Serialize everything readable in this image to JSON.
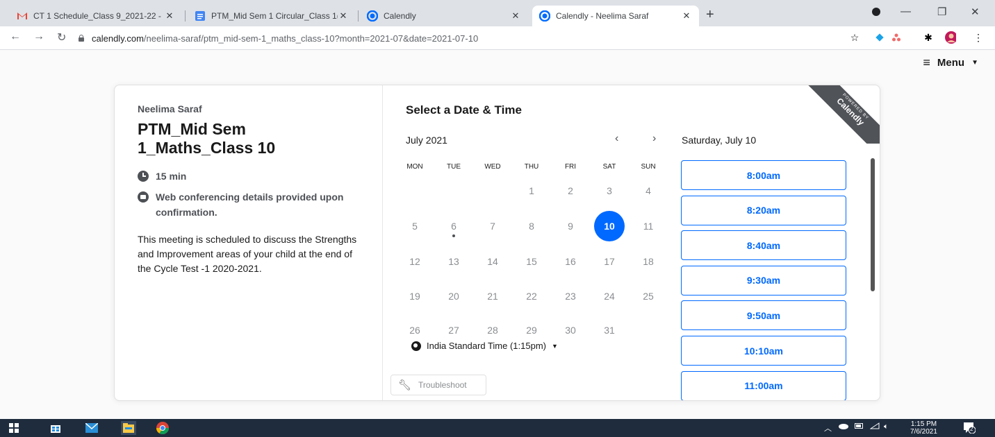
{
  "browser": {
    "tabs": [
      {
        "title": "CT 1 Schedule_Class 9_2021-22 -",
        "icon": "gmail-icon",
        "active": false
      },
      {
        "title": "PTM_Mid Sem 1 Circular_Class 1(",
        "icon": "docs-icon",
        "active": false
      },
      {
        "title": "Calendly",
        "icon": "calendly-icon",
        "active": false
      },
      {
        "title": "Calendly - Neelima Saraf",
        "icon": "calendly-icon",
        "active": true
      }
    ],
    "url_host": "calendly.com",
    "url_path": "/neelima-saraf/ptm_mid-sem-1_maths_class-10?month=2021-07&date=2021-07-10"
  },
  "header": {
    "menu_label": "Menu"
  },
  "event": {
    "organizer": "Neelima Saraf",
    "title": "PTM_Mid Sem 1_Maths_Class 10",
    "duration": "15 min",
    "location": "Web conferencing details provided upon confirmation.",
    "description": "This meeting is scheduled to discuss the Strengths and Improvement areas of your child at the end of the Cycle Test -1 2020-2021."
  },
  "scheduler": {
    "heading": "Select a Date & Time",
    "month": "July 2021",
    "prev_icon": "chevron-left-icon",
    "next_icon": "chevron-right-icon",
    "weekdays": [
      "MON",
      "TUE",
      "WED",
      "THU",
      "FRI",
      "SAT",
      "SUN"
    ],
    "days": [
      "1",
      "2",
      "3",
      "4",
      "5",
      "6",
      "7",
      "8",
      "9",
      "10",
      "11",
      "12",
      "13",
      "14",
      "15",
      "16",
      "17",
      "18",
      "19",
      "20",
      "21",
      "22",
      "23",
      "24",
      "25",
      "26",
      "27",
      "28",
      "29",
      "30",
      "31"
    ],
    "selected_day": "10",
    "today_day": "6",
    "timezone": "India Standard Time (1:15pm)",
    "troubleshoot": "Troubleshoot",
    "selected_date_label": "Saturday, July 10",
    "time_slots": [
      "8:00am",
      "8:20am",
      "8:40am",
      "9:30am",
      "9:50am",
      "10:10am",
      "11:00am"
    ],
    "badge_small": "POWERED BY",
    "badge_big": "Calendly"
  },
  "taskbar": {
    "time": "1:15 PM",
    "date": "7/6/2021",
    "notifications": "2"
  },
  "colors": {
    "accent": "#0069ff",
    "taskbar": "#1f2c3e"
  }
}
